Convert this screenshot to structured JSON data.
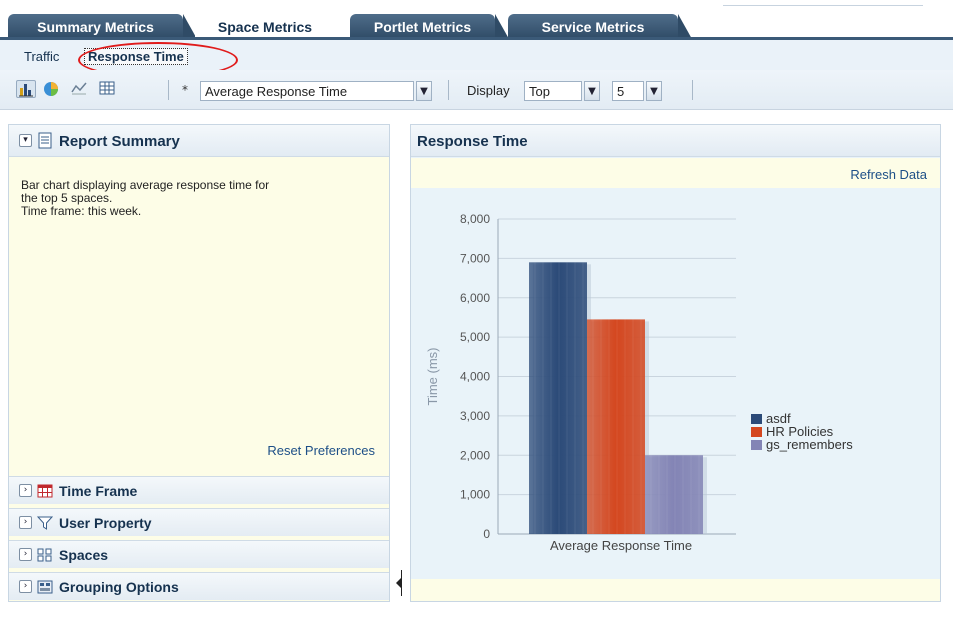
{
  "top_tabs": [
    {
      "label": "Summary Metrics",
      "active": false
    },
    {
      "label": "Space Metrics",
      "active": true
    },
    {
      "label": "Portlet Metrics",
      "active": false
    },
    {
      "label": "Service Metrics",
      "active": false
    }
  ],
  "sub_tabs": [
    {
      "label": "Traffic",
      "active": false
    },
    {
      "label": "Response Time",
      "active": true
    }
  ],
  "toolbar": {
    "chart_types": [
      {
        "icon": "bar-chart-icon",
        "selected": true
      },
      {
        "icon": "pie-chart-icon",
        "selected": false
      },
      {
        "icon": "line-chart-icon",
        "selected": false
      },
      {
        "icon": "table-icon",
        "selected": false
      }
    ],
    "required_marker": "*",
    "metric_select": "Average Response Time",
    "display_label": "Display",
    "display_select": "Top",
    "count_select": "5"
  },
  "left_panel": {
    "title": "Report Summary",
    "description_line1": "Bar chart displaying average response time for",
    "description_line2": "the top 5 spaces.",
    "description_line3": "Time frame: this week.",
    "reset_link": "Reset Preferences",
    "accordion": [
      {
        "label": "Time Frame",
        "icon": "calendar-icon"
      },
      {
        "label": "User Property",
        "icon": "filter-icon"
      },
      {
        "label": "Spaces",
        "icon": "spaces-icon"
      },
      {
        "label": "Grouping Options",
        "icon": "grouping-icon"
      }
    ]
  },
  "right_panel": {
    "title": "Response Time",
    "refresh_link": "Refresh Data"
  },
  "chart_data": {
    "type": "bar",
    "title": "",
    "categories": [
      "Average Response Time"
    ],
    "series": [
      {
        "name": "asdf",
        "values": [
          6900
        ],
        "color": "#2b4a78"
      },
      {
        "name": "HR Policies",
        "values": [
          5450
        ],
        "color": "#d4471f"
      },
      {
        "name": "gs_remembers",
        "values": [
          2000
        ],
        "color": "#8384b5"
      }
    ],
    "xlabel": "",
    "ylabel": "Time (ms)",
    "ylim": [
      0,
      8000
    ],
    "yticks": [
      "0",
      "1,000",
      "2,000",
      "3,000",
      "4,000",
      "5,000",
      "6,000",
      "7,000",
      "8,000"
    ],
    "grid": true,
    "legend": "right"
  }
}
